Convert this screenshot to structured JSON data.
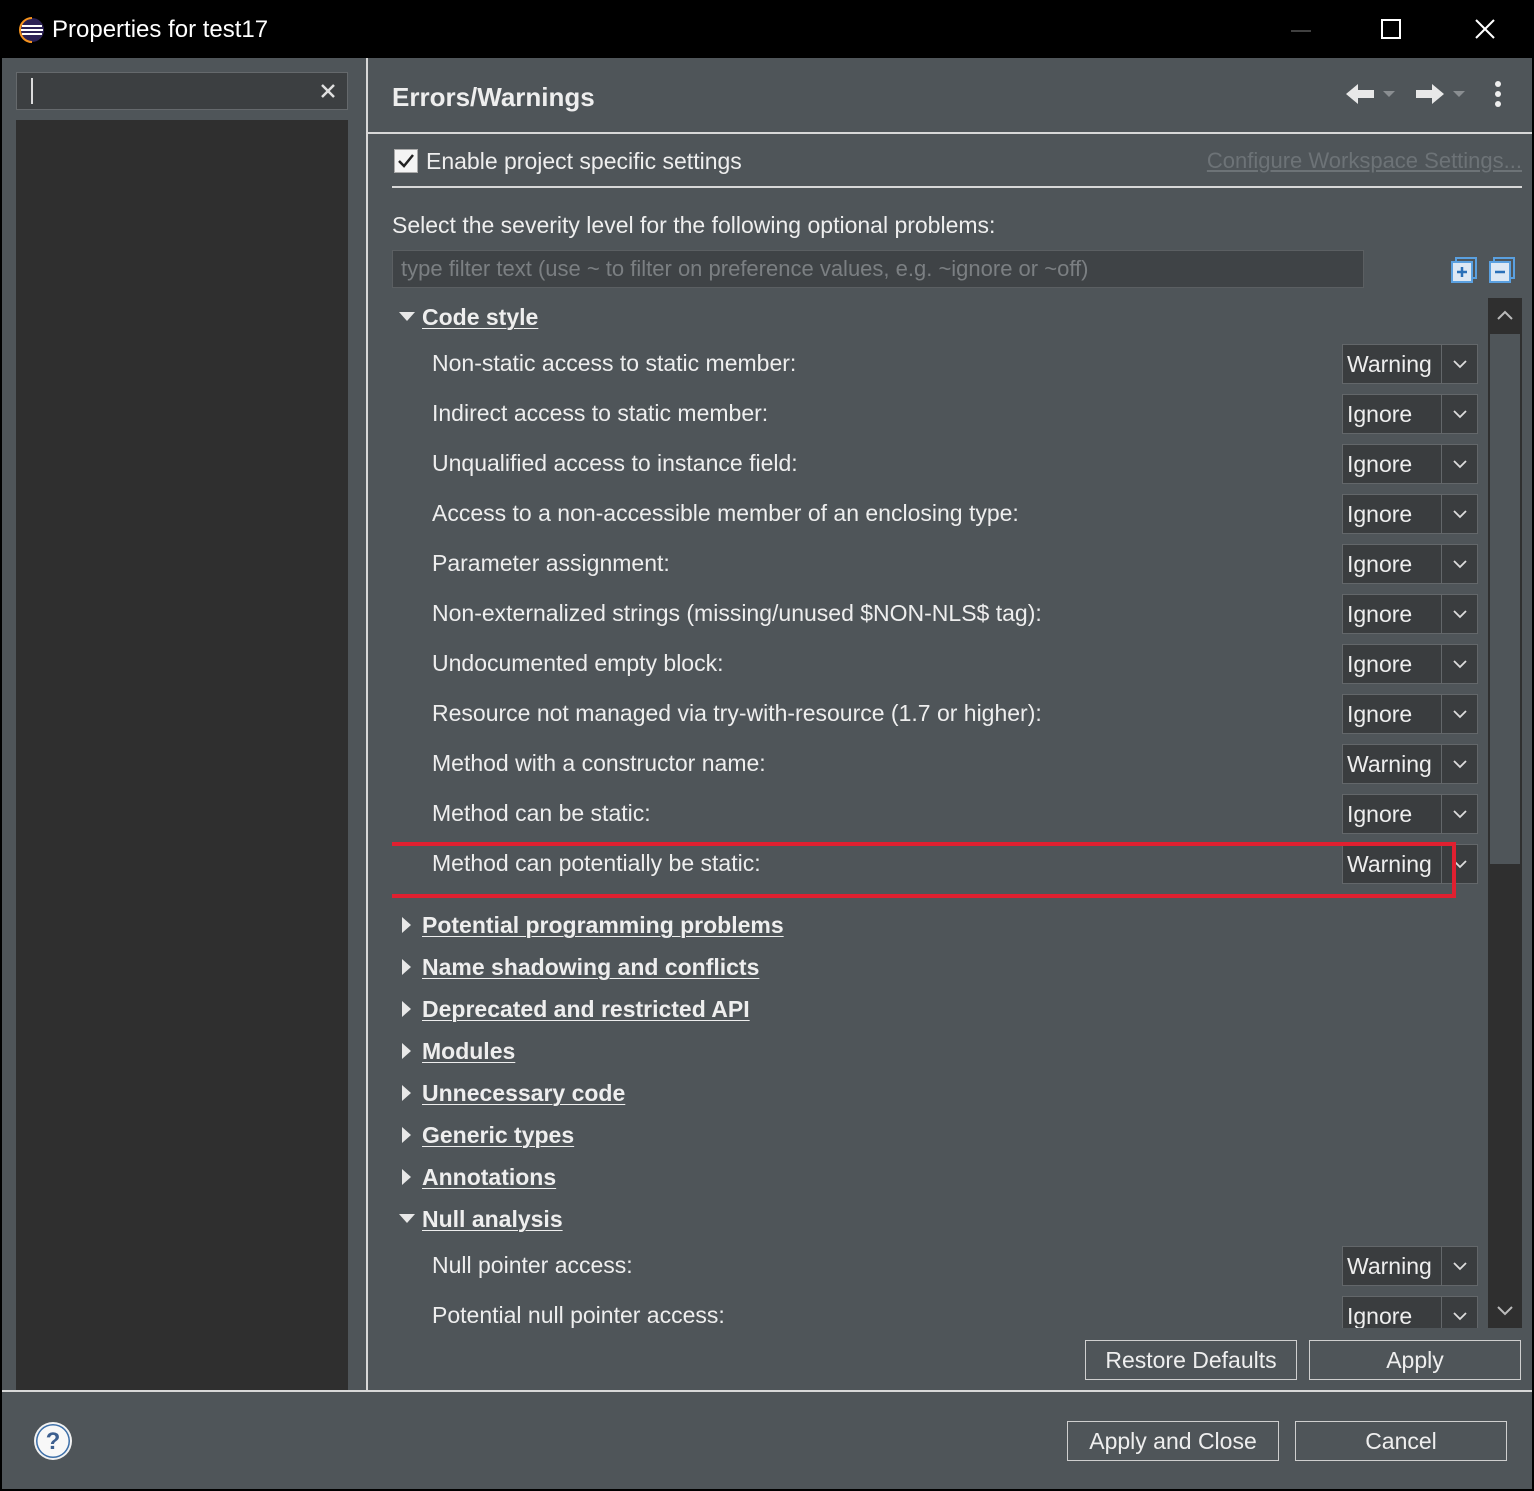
{
  "window": {
    "title": "Properties for test17"
  },
  "left": {
    "filter_value": ""
  },
  "page": {
    "title": "Errors/Warnings",
    "enable_label": "Enable project specific settings",
    "enable_checked": true,
    "config_link": "Configure Workspace Settings...",
    "severity_label": "Select the severity level for the following optional problems:",
    "filter_placeholder": "type filter text (use ~ to filter on preference values, e.g. ~ignore or ~off)"
  },
  "sections": [
    {
      "label": "Code style",
      "expanded": true
    },
    {
      "label": "Potential programming problems",
      "expanded": false
    },
    {
      "label": "Name shadowing and conflicts",
      "expanded": false
    },
    {
      "label": "Deprecated and restricted API",
      "expanded": false
    },
    {
      "label": "Modules",
      "expanded": false
    },
    {
      "label": "Unnecessary code",
      "expanded": false
    },
    {
      "label": "Generic types",
      "expanded": false
    },
    {
      "label": "Annotations",
      "expanded": false
    },
    {
      "label": "Null analysis",
      "expanded": true
    }
  ],
  "code_style_options": [
    {
      "label": "Non-static access to static member:",
      "value": "Warning"
    },
    {
      "label": "Indirect access to static member:",
      "value": "Ignore"
    },
    {
      "label": "Unqualified access to instance field:",
      "value": "Ignore"
    },
    {
      "label": "Access to a non-accessible member of an enclosing type:",
      "value": "Ignore"
    },
    {
      "label": "Parameter assignment:",
      "value": "Ignore"
    },
    {
      "label": "Non-externalized strings (missing/unused $NON-NLS$ tag):",
      "value": "Ignore"
    },
    {
      "label": "Undocumented empty block:",
      "value": "Ignore"
    },
    {
      "label": "Resource not managed via try-with-resource (1.7 or higher):",
      "value": "Ignore"
    },
    {
      "label": "Method with a constructor name:",
      "value": "Warning"
    },
    {
      "label": "Method can be static:",
      "value": "Ignore"
    },
    {
      "label": "Method can potentially be static:",
      "value": "Warning"
    }
  ],
  "null_analysis_options": [
    {
      "label": "Null pointer access:",
      "value": "Warning"
    },
    {
      "label": "Potential null pointer access:",
      "value": "Ignore"
    }
  ],
  "buttons": {
    "restore_defaults": "Restore Defaults",
    "apply": "Apply",
    "apply_and_close": "Apply and Close",
    "cancel": "Cancel"
  },
  "colors": {
    "highlight": "#e02030",
    "background": "#4f5559"
  }
}
